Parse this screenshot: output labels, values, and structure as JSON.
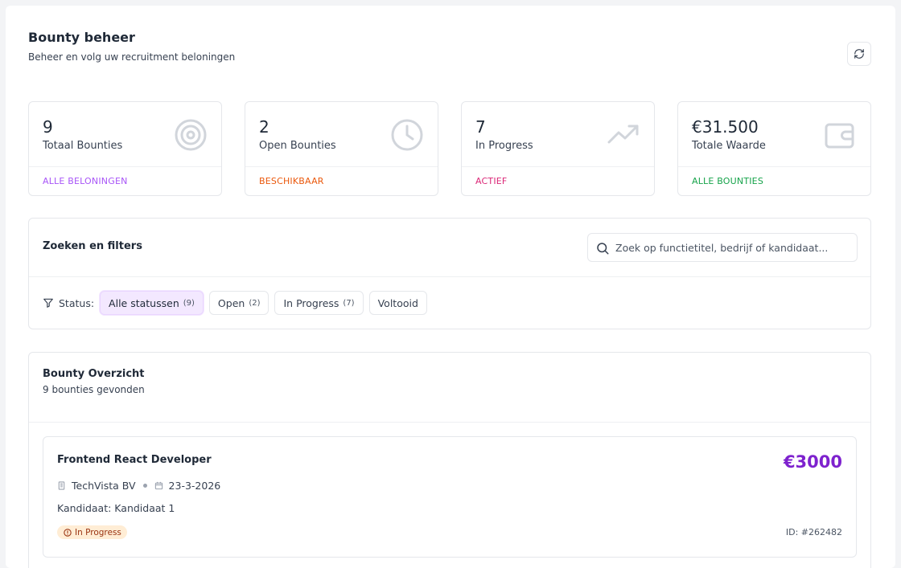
{
  "header": {
    "title": "Bounty beheer",
    "subtitle": "Beheer en volg uw recruitment beloningen",
    "refresh_icon": "refresh-icon"
  },
  "stats": [
    {
      "value": "9",
      "label": "Totaal Bounties",
      "footer": "ALLE BELONINGEN",
      "icon": "target-icon",
      "color": "#a855f7"
    },
    {
      "value": "2",
      "label": "Open Bounties",
      "footer": "BESCHIKBAAR",
      "icon": "clock-icon",
      "color": "#ea580c"
    },
    {
      "value": "7",
      "label": "In Progress",
      "footer": "ACTIEF",
      "icon": "trending-up-icon",
      "color": "#db2777"
    },
    {
      "value": "€31.500",
      "label": "Totale Waarde",
      "footer": "ALLE BOUNTIES",
      "icon": "wallet-icon",
      "color": "#16a34a"
    }
  ],
  "filters": {
    "title": "Zoeken en filters",
    "search_placeholder": "Zoek op functietitel, bedrijf of kandidaat...",
    "search_value": "",
    "status_label": "Status:",
    "chips": [
      {
        "label": "Alle statussen",
        "count": "(9)",
        "active": true
      },
      {
        "label": "Open",
        "count": "(2)",
        "active": false
      },
      {
        "label": "In Progress",
        "count": "(7)",
        "active": false
      },
      {
        "label": "Voltooid",
        "count": "",
        "active": false
      }
    ]
  },
  "overview": {
    "title": "Bounty Overzicht",
    "count_text": "9 bounties gevonden",
    "bounties": [
      {
        "title": "Frontend React Developer",
        "amount": "€3000",
        "company": "TechVista BV",
        "date": "23-3-2026",
        "candidate": "Kandidaat: Kandidaat 1",
        "status": "In Progress",
        "id": "ID: #262482"
      }
    ]
  },
  "colors": {
    "accent_purple": "#7e22ce",
    "chip_active_bg": "#f3e8ff",
    "badge_progress_bg": "#ffedd5",
    "icon_gray": "#d1d5db"
  }
}
